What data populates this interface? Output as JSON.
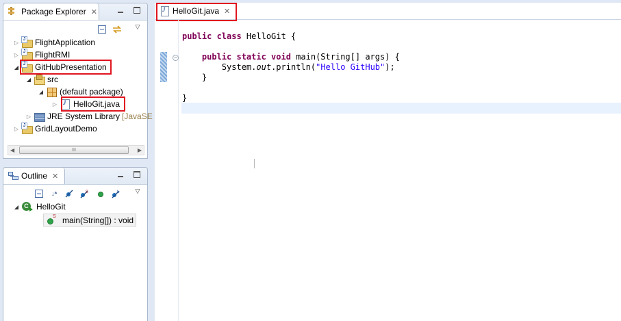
{
  "package_explorer": {
    "title": "Package Explorer",
    "tree": [
      {
        "label": "FlightApplication",
        "suffix": ""
      },
      {
        "label": "FlightRMI",
        "suffix": ""
      },
      {
        "label": "GitHubPresentation",
        "suffix": ""
      },
      {
        "label": "src",
        "suffix": ""
      },
      {
        "label": "(default package)",
        "suffix": ""
      },
      {
        "label": "HelloGit.java",
        "suffix": ""
      },
      {
        "label": "JRE System Library",
        "suffix": "[JavaSE"
      },
      {
        "label": "GridLayoutDemo",
        "suffix": ""
      }
    ],
    "scroll_grip": "III"
  },
  "outline": {
    "title": "Outline",
    "class_name": "HelloGit",
    "method_label": "main(String[]) : void"
  },
  "editor": {
    "tab_label": "HelloGit.java",
    "lines": {
      "l1_kw": "public class",
      "l1_rest": " HelloGit {",
      "l3_kw1": "public static void",
      "l3_rest": " main(String[] args) {",
      "l4_pre": "System.",
      "l4_it": "out",
      "l4_mid": ".println(",
      "l4_str": "\"Hello GitHub\"",
      "l4_end": ");",
      "l5": "}",
      "l7": "}"
    }
  },
  "colors": {
    "highlight": "#e0141e",
    "keyword": "#7f0055",
    "string": "#2a00ff",
    "current_line": "#e8f2fe"
  }
}
